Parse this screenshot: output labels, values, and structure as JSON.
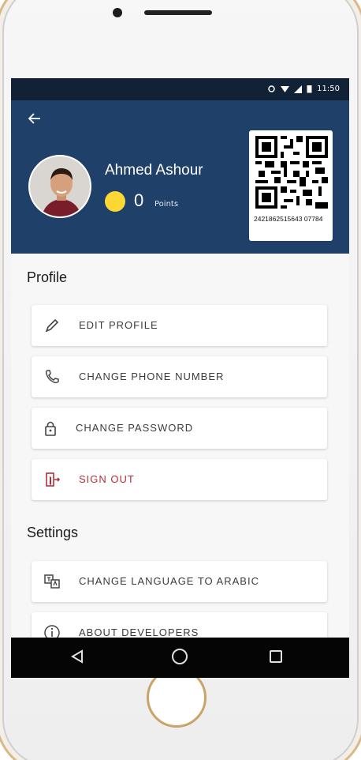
{
  "status_bar": {
    "time": "11:50"
  },
  "profile": {
    "name": "Ahmed Ashour",
    "points_value": "0",
    "points_label": "Points",
    "qr_number": "2421862515643 07784"
  },
  "sections": {
    "profile_title": "Profile",
    "settings_title": "Settings"
  },
  "menu": {
    "edit_profile": "EDIT PROFILE",
    "change_phone": "CHANGE PHONE NUMBER",
    "change_password": "CHANGE PASSWORD",
    "sign_out": "SIGN OUT",
    "change_language": "CHANGE LANGUAGE TO ARABIC",
    "about_developers": "ABOUT DEVELOPERS"
  },
  "icons": {
    "back": "back-arrow-icon",
    "edit": "pencil-icon",
    "phone": "phone-icon",
    "password": "lock-icon",
    "sign_out": "exit-icon",
    "language": "translate-icon",
    "about": "info-icon"
  },
  "colors": {
    "header": "#1f4068",
    "status_bar": "#112236",
    "coin": "#fdd835",
    "sign_out": "#b0303a"
  }
}
